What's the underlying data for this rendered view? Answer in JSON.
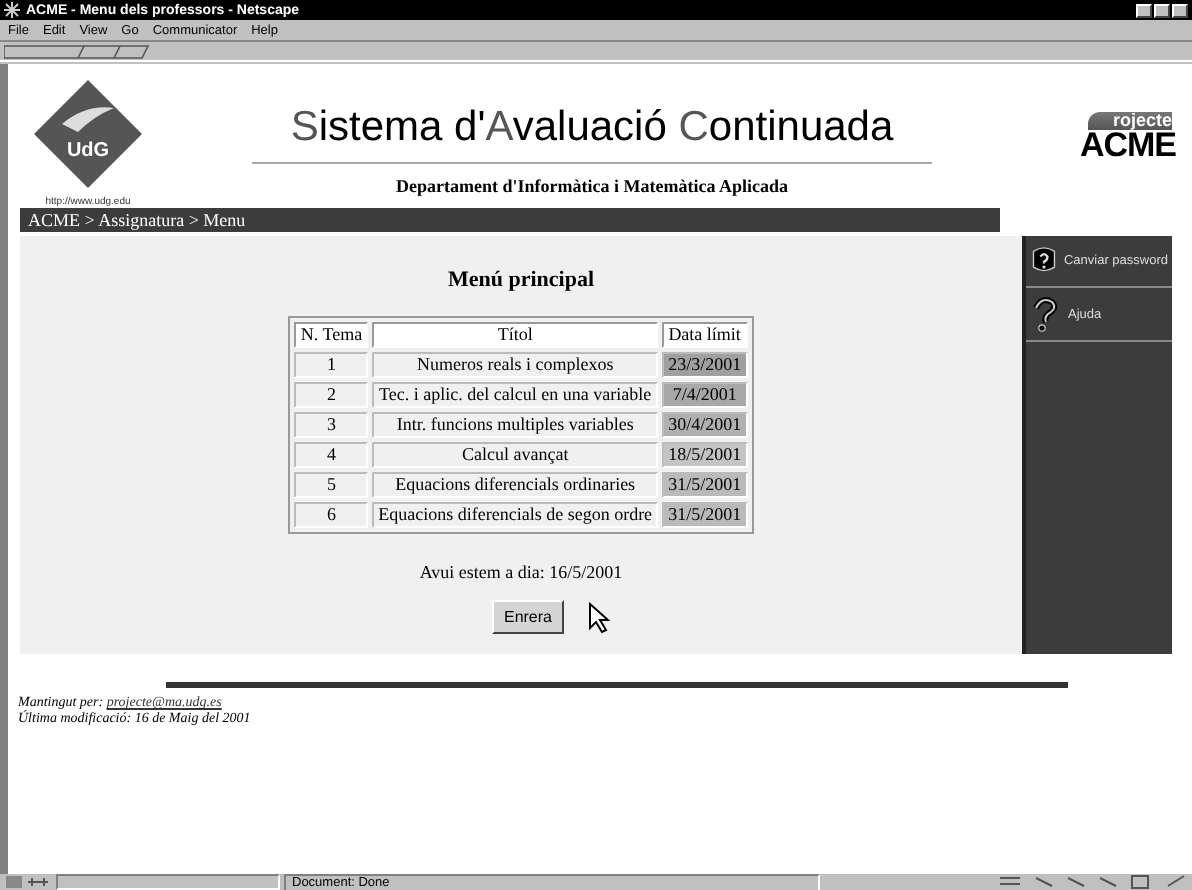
{
  "window": {
    "title": "ACME - Menu dels professors - Netscape"
  },
  "menu_bar": [
    "File",
    "Edit",
    "View",
    "Go",
    "Communicator",
    "Help"
  ],
  "header": {
    "logo_text": "UdG",
    "logo_url": "http://www.udg.edu",
    "title_parts": [
      {
        "text": "S",
        "accent": true
      },
      {
        "text": "istema d'",
        "accent": false
      },
      {
        "text": "A",
        "accent": true
      },
      {
        "text": "valuació ",
        "accent": false
      },
      {
        "text": "C",
        "accent": true
      },
      {
        "text": "ontinuada",
        "accent": false
      }
    ],
    "subtitle": "Departament d'Informàtica i Matemàtica Aplicada",
    "brand_small": "rojecte",
    "brand": "ACME"
  },
  "breadcrumb": "ACME > Assignatura > Menu",
  "main": {
    "heading": "Menú principal",
    "table": {
      "columns": [
        "N. Tema",
        "Títol",
        "Data límit"
      ],
      "rows": [
        {
          "number": "1",
          "title": "Numeros reals i complexos",
          "deadline": "23/3/2001",
          "color": "#a0a0a0"
        },
        {
          "number": "2",
          "title": "Tec. i aplic. del calcul en una variable",
          "deadline": "7/4/2001",
          "color": "#a8a8a8"
        },
        {
          "number": "3",
          "title": "Intr. funcions multiples variables",
          "deadline": "30/4/2001",
          "color": "#b0b0b0"
        },
        {
          "number": "4",
          "title": "Calcul avançat",
          "deadline": "18/5/2001",
          "color": "#c4c4c4"
        },
        {
          "number": "5",
          "title": "Equacions diferencials ordinaries",
          "deadline": "31/5/2001",
          "color": "#bababa"
        },
        {
          "number": "6",
          "title": "Equacions diferencials de segon ordre",
          "deadline": "31/5/2001",
          "color": "#bababa"
        }
      ]
    },
    "today": "Avui estem a dia: 16/5/2001",
    "back_button": "Enrera"
  },
  "sidebar": [
    {
      "kind": "password",
      "label": "Canviar password"
    },
    {
      "kind": "help",
      "label": "Ajuda"
    }
  ],
  "footer": {
    "maintainer_label": "Mantingut per:",
    "maintainer_email": "projecte@ma.udg.es",
    "modified": "Última modificació: 16 de Maig del 2001"
  },
  "status_bar": "Document: Done"
}
